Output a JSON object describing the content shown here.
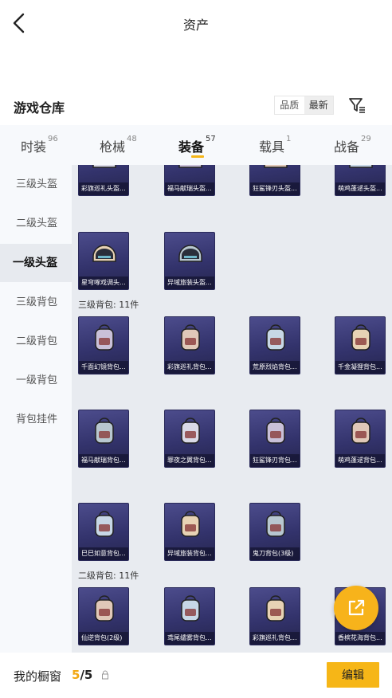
{
  "header": {
    "title": "资产"
  },
  "section": {
    "title": "游戏仓库"
  },
  "sort": {
    "options": [
      "品质",
      "最新"
    ],
    "active_index": 1
  },
  "icons": {
    "back": "back-chevron-icon",
    "filter": "filter-icon",
    "share": "share-external-icon",
    "lock": "lock-icon"
  },
  "colors": {
    "accent": "#f6b617",
    "card_bg": "#3a3a78"
  },
  "tabs": [
    {
      "label": "时装",
      "count": "96"
    },
    {
      "label": "枪械",
      "count": "48"
    },
    {
      "label": "装备",
      "count": "57",
      "active": true
    },
    {
      "label": "载具",
      "count": "1"
    },
    {
      "label": "战备",
      "count": "29"
    }
  ],
  "sidebar": {
    "items": [
      "三级头盔",
      "二级头盔",
      "一级头盔",
      "三级背包",
      "二级背包",
      "一级背包",
      "背包挂件"
    ],
    "active_index": 2
  },
  "groups": [
    {
      "label": "",
      "items": [
        "彩旗巡礼头盔...",
        "福马献瑞头盔...",
        "狂鲨锋刃头盔...",
        "萌鸡蓬逑头盔...",
        "星穹啄戏调头...",
        "异域旅装头盔..."
      ]
    },
    {
      "label": "三级背包: 11件",
      "items": [
        "千面幻镜背包...",
        "彩旗巡礼背包...",
        "荒原烈焰背包...",
        "千金凝狸背包...",
        "福马献瑞背包...",
        "罪夜之翼背包...",
        "狂鲨锋刃背包...",
        "萌鸡蓬逑背包...",
        "巳巳如意背包...",
        "异域旅装背包...",
        "鬼刀背包(3级)"
      ]
    },
    {
      "label": "二级背包: 11件",
      "items": [
        "仙逆背包(2级)",
        "鸢尾缱雾背包...",
        "彩旗巡礼背包...",
        "香槟花海背包..."
      ]
    }
  ],
  "bottom": {
    "label": "我的橱窗",
    "current": "5",
    "total": "/5",
    "edit_label": "编辑"
  }
}
